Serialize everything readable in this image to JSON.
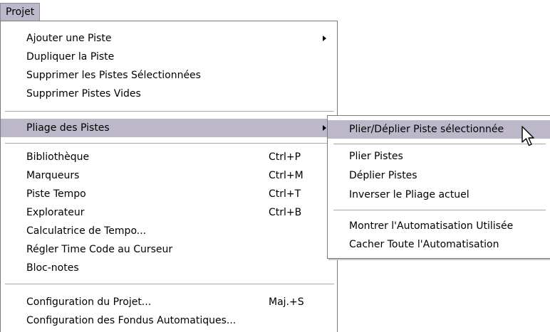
{
  "menubar": {
    "projet_label": "Projet"
  },
  "main_menu": {
    "items": [
      {
        "label": "Ajouter une Piste"
      },
      {
        "label": "Dupliquer la Piste"
      },
      {
        "label": "Supprimer les Pistes Sélectionnées"
      },
      {
        "label": "Supprimer Pistes Vides"
      },
      {
        "label": "Pliage des Pistes"
      },
      {
        "label": "Bibliothèque",
        "shortcut": "Ctrl+P"
      },
      {
        "label": "Marqueurs",
        "shortcut": "Ctrl+M"
      },
      {
        "label": "Piste Tempo",
        "shortcut": "Ctrl+T"
      },
      {
        "label": "Explorateur",
        "shortcut": "Ctrl+B"
      },
      {
        "label": "Calculatrice de Tempo..."
      },
      {
        "label": "Régler Time Code au Curseur"
      },
      {
        "label": "Bloc-notes"
      },
      {
        "label": "Configuration du Projet...",
        "shortcut": "Maj.+S"
      },
      {
        "label": "Configuration des Fondus Automatiques..."
      }
    ]
  },
  "sub_menu": {
    "items": [
      {
        "label": "Plier/Déplier Piste sélectionnée"
      },
      {
        "label": "Plier Pistes"
      },
      {
        "label": "Déplier Pistes"
      },
      {
        "label": "Inverser le Pliage actuel"
      },
      {
        "label": "Montrer l'Automatisation Utilisée"
      },
      {
        "label": "Cacher Toute l'Automatisation"
      }
    ]
  },
  "colors": {
    "highlight": "#bcb8c9",
    "menu_border": "#7a7a7a"
  },
  "icons": {
    "submenu_arrow": "triangle-right",
    "cursor": "mouse-pointer-arrow"
  }
}
